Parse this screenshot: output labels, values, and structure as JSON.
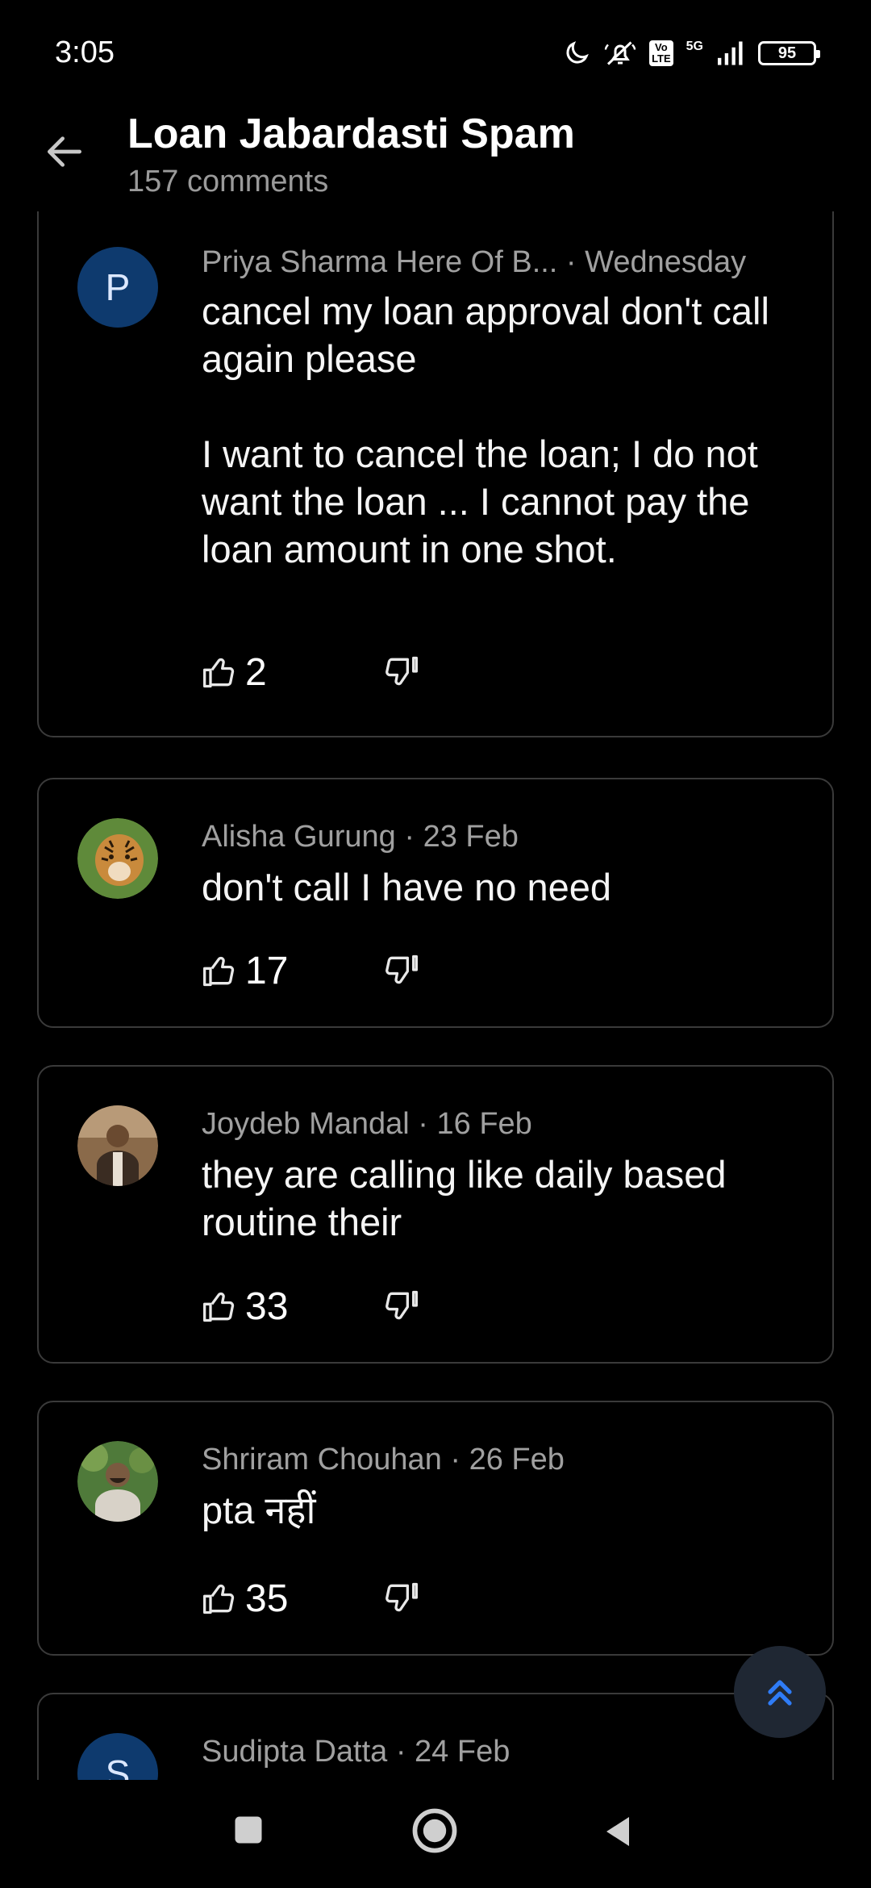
{
  "status_bar": {
    "time": "3:05",
    "battery": "95",
    "network": "5G",
    "volte": "Vo\nLTE",
    "icons": [
      "moon-icon",
      "silent-icon",
      "volte-icon",
      "signal-icon",
      "battery-icon"
    ]
  },
  "header": {
    "title": "Loan Jabardasti Spam",
    "subtitle": "157 comments"
  },
  "comments": [
    {
      "avatar_letter": "P",
      "author": "Priya Sharma Here Of B...",
      "date": " · Wednesday",
      "text": "cancel my loan approval don't call again please\n\nI want to cancel the loan; I do not want the loan ... I cannot pay the loan amount in one shot.",
      "likes": "2"
    },
    {
      "author": "Alisha Gurung",
      "date": " · 23 Feb",
      "text": "don't call I have no need",
      "likes": "17"
    },
    {
      "author": "Joydeb Mandal",
      "date": " · 16 Feb",
      "text": "they are calling like daily based routine their",
      "likes": "33"
    },
    {
      "author": "Shriram Chouhan",
      "date": " · 26 Feb",
      "text": "pta नहीं",
      "likes": "35"
    },
    {
      "avatar_letter": "S",
      "author": "Sudipta Datta",
      "date": " · 24 Feb"
    }
  ],
  "colors": {
    "background": "#000000",
    "card_border": "#3a3a3a",
    "accent": "#2f7cf6",
    "muted_text": "#a0a0a0"
  }
}
